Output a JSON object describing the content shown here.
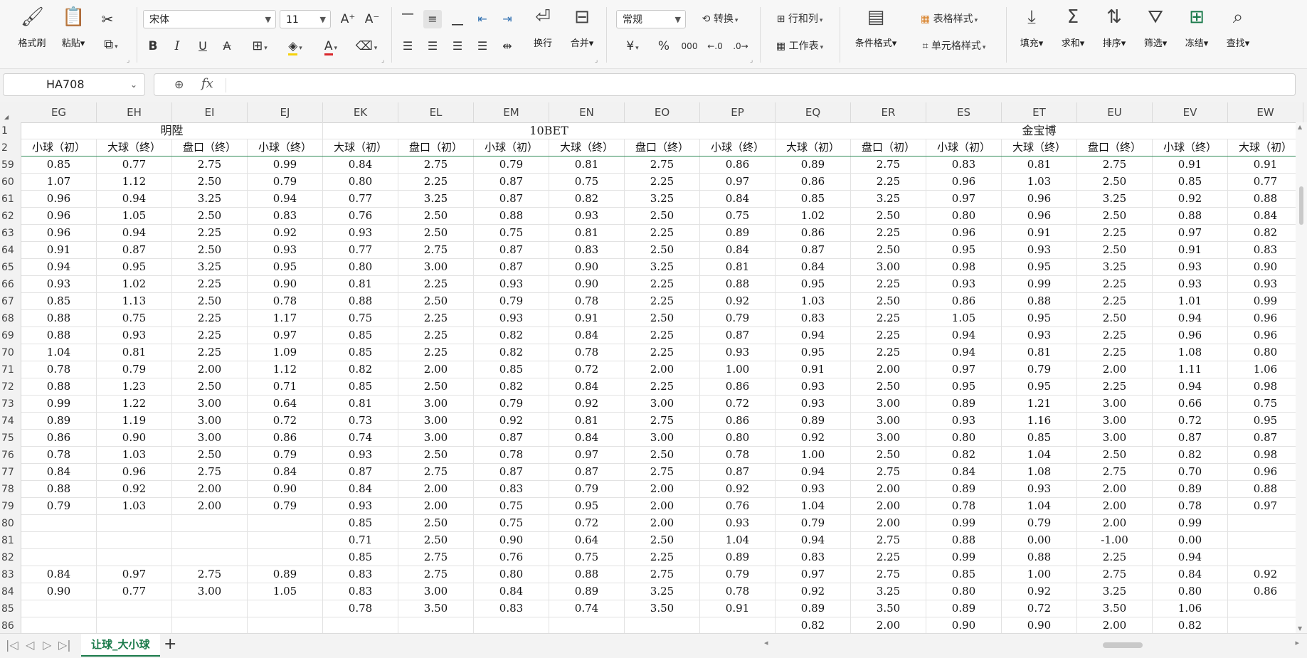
{
  "ribbon": {
    "clipboard": {
      "format_painter": "格式刷",
      "paste": "粘贴"
    },
    "font": {
      "name": "宋体",
      "size": "11",
      "bold": "B",
      "italic": "I",
      "underline": "U"
    },
    "alignment": {
      "wrap": "换行",
      "merge": "合并"
    },
    "number": {
      "format": "常规",
      "convert": "转换"
    },
    "cells": {
      "rowcol": "行和列",
      "worksheet": "工作表"
    },
    "styles": {
      "conditional": "条件格式",
      "table_style": "表格样式",
      "cell_style": "单元格样式"
    },
    "editing": {
      "fill": "填充",
      "sum": "求和",
      "sort": "排序",
      "filter": "筛选",
      "freeze": "冻结",
      "find": "查找"
    }
  },
  "formula_bar": {
    "name_box": "HA708",
    "fx": "fx",
    "value": ""
  },
  "columns": [
    "EG",
    "EH",
    "EI",
    "EJ",
    "EK",
    "EL",
    "EM",
    "EN",
    "EO",
    "EP",
    "EQ",
    "ER",
    "ES",
    "ET",
    "EU",
    "EV",
    "EW"
  ],
  "groups": [
    {
      "label": "明陞"
    },
    {
      "label": "10BET"
    },
    {
      "label": "金宝博"
    }
  ],
  "subheaders": [
    "小球（初）",
    "大球（终）",
    "盘口（终）",
    "小球（终）",
    "大球（初）",
    "盘口（初）",
    "小球（初）",
    "大球（终）",
    "盘口（终）",
    "小球（终）",
    "大球（初）",
    "盘口（初）",
    "小球（初）",
    "大球（终）",
    "盘口（终）",
    "小球（终）",
    "大球（初）"
  ],
  "rows": [
    {
      "n": "59",
      "v": [
        "0.85",
        "0.77",
        "2.75",
        "0.99",
        "0.84",
        "2.75",
        "0.79",
        "0.81",
        "2.75",
        "0.86",
        "0.89",
        "2.75",
        "0.83",
        "0.81",
        "2.75",
        "0.91",
        "0.91"
      ]
    },
    {
      "n": "60",
      "v": [
        "1.07",
        "1.12",
        "2.50",
        "0.79",
        "0.80",
        "2.25",
        "0.87",
        "0.75",
        "2.25",
        "0.97",
        "0.86",
        "2.25",
        "0.96",
        "1.03",
        "2.50",
        "0.85",
        "0.77"
      ]
    },
    {
      "n": "61",
      "v": [
        "0.96",
        "0.94",
        "3.25",
        "0.94",
        "0.77",
        "3.25",
        "0.87",
        "0.82",
        "3.25",
        "0.84",
        "0.85",
        "3.25",
        "0.97",
        "0.96",
        "3.25",
        "0.92",
        "0.88"
      ]
    },
    {
      "n": "62",
      "v": [
        "0.96",
        "1.05",
        "2.50",
        "0.83",
        "0.76",
        "2.50",
        "0.88",
        "0.93",
        "2.50",
        "0.75",
        "1.02",
        "2.50",
        "0.80",
        "0.96",
        "2.50",
        "0.88",
        "0.84"
      ]
    },
    {
      "n": "63",
      "v": [
        "0.96",
        "0.94",
        "2.25",
        "0.92",
        "0.93",
        "2.50",
        "0.75",
        "0.81",
        "2.25",
        "0.89",
        "0.86",
        "2.25",
        "0.96",
        "0.91",
        "2.25",
        "0.97",
        "0.82"
      ]
    },
    {
      "n": "64",
      "v": [
        "0.91",
        "0.87",
        "2.50",
        "0.93",
        "0.77",
        "2.75",
        "0.87",
        "0.83",
        "2.50",
        "0.84",
        "0.87",
        "2.50",
        "0.95",
        "0.93",
        "2.50",
        "0.91",
        "0.83"
      ]
    },
    {
      "n": "65",
      "v": [
        "0.94",
        "0.95",
        "3.25",
        "0.95",
        "0.80",
        "3.00",
        "0.87",
        "0.90",
        "3.25",
        "0.81",
        "0.84",
        "3.00",
        "0.98",
        "0.95",
        "3.25",
        "0.93",
        "0.90"
      ]
    },
    {
      "n": "66",
      "v": [
        "0.93",
        "1.02",
        "2.25",
        "0.90",
        "0.81",
        "2.25",
        "0.93",
        "0.90",
        "2.25",
        "0.88",
        "0.95",
        "2.25",
        "0.93",
        "0.99",
        "2.25",
        "0.93",
        "0.93"
      ]
    },
    {
      "n": "67",
      "v": [
        "0.85",
        "1.13",
        "2.50",
        "0.78",
        "0.88",
        "2.50",
        "0.79",
        "0.78",
        "2.25",
        "0.92",
        "1.03",
        "2.50",
        "0.86",
        "0.88",
        "2.25",
        "1.01",
        "0.99"
      ]
    },
    {
      "n": "68",
      "v": [
        "0.88",
        "0.75",
        "2.25",
        "1.17",
        "0.75",
        "2.25",
        "0.93",
        "0.91",
        "2.50",
        "0.79",
        "0.83",
        "2.25",
        "1.05",
        "0.95",
        "2.50",
        "0.94",
        "0.96"
      ]
    },
    {
      "n": "69",
      "v": [
        "0.88",
        "0.93",
        "2.25",
        "0.97",
        "0.85",
        "2.25",
        "0.82",
        "0.84",
        "2.25",
        "0.87",
        "0.94",
        "2.25",
        "0.94",
        "0.93",
        "2.25",
        "0.96",
        "0.96"
      ]
    },
    {
      "n": "70",
      "v": [
        "1.04",
        "0.81",
        "2.25",
        "1.09",
        "0.85",
        "2.25",
        "0.82",
        "0.78",
        "2.25",
        "0.93",
        "0.95",
        "2.25",
        "0.94",
        "0.81",
        "2.25",
        "1.08",
        "0.80"
      ]
    },
    {
      "n": "71",
      "v": [
        "0.78",
        "0.79",
        "2.00",
        "1.12",
        "0.82",
        "2.00",
        "0.85",
        "0.72",
        "2.00",
        "1.00",
        "0.91",
        "2.00",
        "0.97",
        "0.79",
        "2.00",
        "1.11",
        "1.06"
      ]
    },
    {
      "n": "72",
      "v": [
        "0.88",
        "1.23",
        "2.50",
        "0.71",
        "0.85",
        "2.50",
        "0.82",
        "0.84",
        "2.25",
        "0.86",
        "0.93",
        "2.50",
        "0.95",
        "0.95",
        "2.25",
        "0.94",
        "0.98"
      ]
    },
    {
      "n": "73",
      "v": [
        "0.99",
        "1.22",
        "3.00",
        "0.64",
        "0.81",
        "3.00",
        "0.79",
        "0.92",
        "3.00",
        "0.72",
        "0.93",
        "3.00",
        "0.89",
        "1.21",
        "3.00",
        "0.66",
        "0.75"
      ]
    },
    {
      "n": "74",
      "v": [
        "0.89",
        "1.19",
        "3.00",
        "0.72",
        "0.73",
        "3.00",
        "0.92",
        "0.81",
        "2.75",
        "0.86",
        "0.89",
        "3.00",
        "0.93",
        "1.16",
        "3.00",
        "0.72",
        "0.95"
      ]
    },
    {
      "n": "75",
      "v": [
        "0.86",
        "0.90",
        "3.00",
        "0.86",
        "0.74",
        "3.00",
        "0.87",
        "0.84",
        "3.00",
        "0.80",
        "0.92",
        "3.00",
        "0.80",
        "0.85",
        "3.00",
        "0.87",
        "0.87"
      ]
    },
    {
      "n": "76",
      "v": [
        "0.78",
        "1.03",
        "2.50",
        "0.79",
        "0.93",
        "2.50",
        "0.78",
        "0.97",
        "2.50",
        "0.78",
        "1.00",
        "2.50",
        "0.82",
        "1.04",
        "2.50",
        "0.82",
        "0.98"
      ]
    },
    {
      "n": "77",
      "v": [
        "0.84",
        "0.96",
        "2.75",
        "0.84",
        "0.87",
        "2.75",
        "0.87",
        "0.87",
        "2.75",
        "0.87",
        "0.94",
        "2.75",
        "0.84",
        "1.08",
        "2.75",
        "0.70",
        "0.96"
      ]
    },
    {
      "n": "78",
      "v": [
        "0.88",
        "0.92",
        "2.00",
        "0.90",
        "0.84",
        "2.00",
        "0.83",
        "0.79",
        "2.00",
        "0.92",
        "0.93",
        "2.00",
        "0.89",
        "0.93",
        "2.00",
        "0.89",
        "0.88"
      ]
    },
    {
      "n": "79",
      "v": [
        "0.79",
        "1.03",
        "2.00",
        "0.79",
        "0.93",
        "2.00",
        "0.75",
        "0.95",
        "2.00",
        "0.76",
        "1.04",
        "2.00",
        "0.78",
        "1.04",
        "2.00",
        "0.78",
        "0.97"
      ]
    },
    {
      "n": "80",
      "v": [
        "",
        "",
        "",
        "",
        "0.85",
        "2.50",
        "0.75",
        "0.72",
        "2.00",
        "0.93",
        "0.79",
        "2.00",
        "0.99",
        "0.79",
        "2.00",
        "0.99",
        ""
      ]
    },
    {
      "n": "81",
      "v": [
        "",
        "",
        "",
        "",
        "0.71",
        "2.50",
        "0.90",
        "0.64",
        "2.50",
        "1.04",
        "0.94",
        "2.75",
        "0.88",
        "0.00",
        "-1.00",
        "0.00",
        ""
      ]
    },
    {
      "n": "82",
      "v": [
        "",
        "",
        "",
        "",
        "0.85",
        "2.75",
        "0.76",
        "0.75",
        "2.25",
        "0.89",
        "0.83",
        "2.25",
        "0.99",
        "0.88",
        "2.25",
        "0.94",
        ""
      ]
    },
    {
      "n": "83",
      "v": [
        "0.84",
        "0.97",
        "2.75",
        "0.89",
        "0.83",
        "2.75",
        "0.80",
        "0.88",
        "2.75",
        "0.79",
        "0.97",
        "2.75",
        "0.85",
        "1.00",
        "2.75",
        "0.84",
        "0.92"
      ]
    },
    {
      "n": "84",
      "v": [
        "0.90",
        "0.77",
        "3.00",
        "1.05",
        "0.83",
        "3.00",
        "0.84",
        "0.89",
        "3.25",
        "0.78",
        "0.92",
        "3.25",
        "0.80",
        "0.92",
        "3.25",
        "0.80",
        "0.86"
      ]
    },
    {
      "n": "85",
      "v": [
        "",
        "",
        "",
        "",
        "0.78",
        "3.50",
        "0.83",
        "0.74",
        "3.50",
        "0.91",
        "0.89",
        "3.50",
        "0.89",
        "0.72",
        "3.50",
        "1.06",
        ""
      ]
    },
    {
      "n": "86",
      "v": [
        "",
        "",
        "",
        "",
        "",
        "",
        "",
        "",
        "",
        "",
        "0.82",
        "2.00",
        "0.90",
        "0.90",
        "2.00",
        "0.82",
        ""
      ]
    }
  ],
  "tabs": {
    "active": "让球_大小球",
    "add": "+"
  }
}
